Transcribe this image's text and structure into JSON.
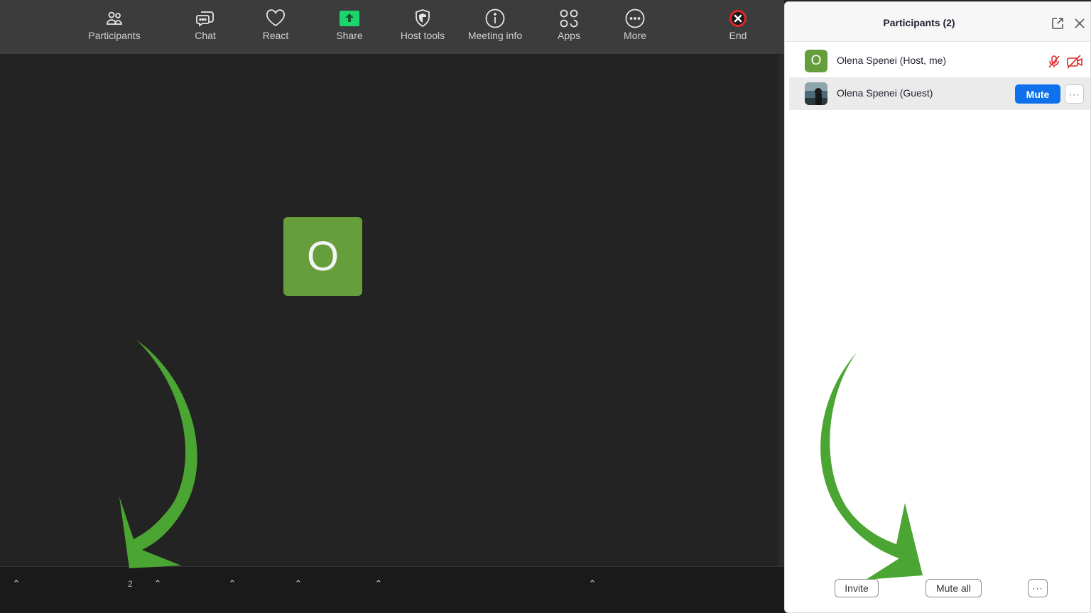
{
  "panel": {
    "title": "Participants (2)",
    "participants": [
      {
        "initial": "O",
        "name": "Olena Spenei (Host, me)",
        "avatar_color": "#659e3a"
      },
      {
        "name": "Olena Spenei (Guest)",
        "mute_label": "Mute",
        "more_label": "···"
      }
    ],
    "footer": {
      "invite_label": "Invite",
      "mute_all_label": "Mute all",
      "more_label": "···"
    }
  },
  "video": {
    "initial": "O",
    "color": "#659e3a"
  },
  "toolbar": {
    "participants_label": "Participants",
    "participants_count": "2",
    "chat_label": "Chat",
    "react_label": "React",
    "share_label": "Share",
    "host_tools_label": "Host tools",
    "meeting_info_label": "Meeting info",
    "apps_label": "Apps",
    "more_label": "More",
    "end_label": "End"
  },
  "colors": {
    "accent_blue": "#0e71eb",
    "share_green": "#1dd36b",
    "end_red": "#e02828",
    "arrow_green": "#4aa532"
  }
}
